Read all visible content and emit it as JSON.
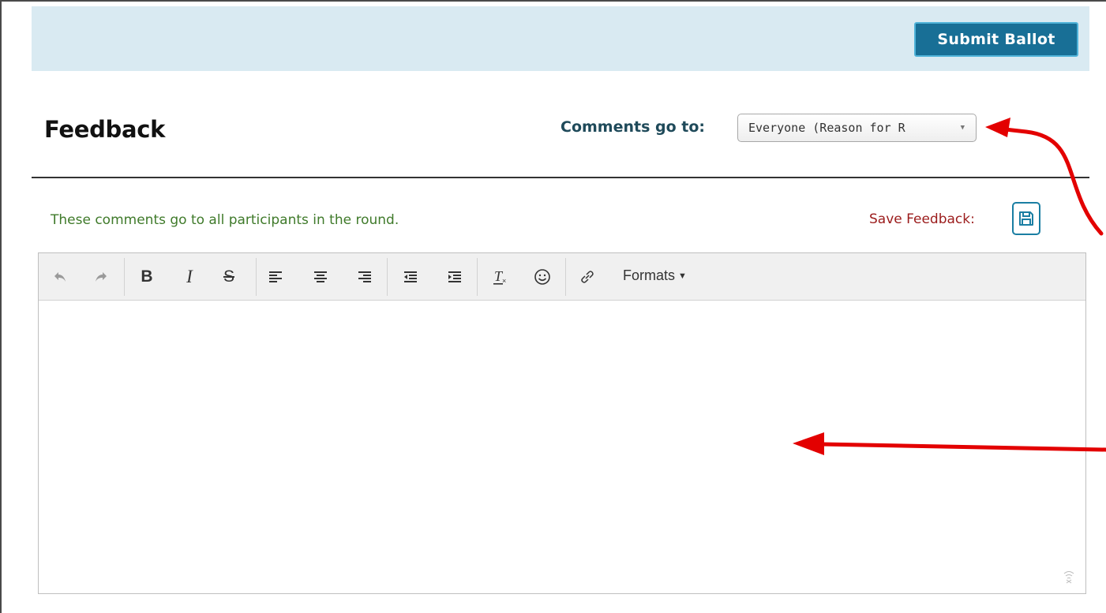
{
  "header": {
    "submit_label": "Submit Ballot"
  },
  "feedback": {
    "title": "Feedback",
    "comments_label": "Comments go to:",
    "recipient_selected": "Everyone (Reason for R",
    "note": "These comments go to all participants in the round.",
    "save_label": "Save Feedback:"
  },
  "editor": {
    "toolbar_icons": [
      "undo-icon",
      "redo-icon",
      "bold-icon",
      "italic-icon",
      "strikethrough-icon",
      "align-left-icon",
      "align-center-icon",
      "align-right-icon",
      "outdent-icon",
      "indent-icon",
      "clear-formatting-icon",
      "emoticons-icon",
      "link-icon"
    ],
    "formats_label": "Formats",
    "content": ""
  },
  "colors": {
    "accent": "#186f96",
    "top_bar": "#d9eaf2",
    "note_green": "#3f7a2a",
    "save_red": "#9b1b1b",
    "annotation_red": "#e30000"
  }
}
